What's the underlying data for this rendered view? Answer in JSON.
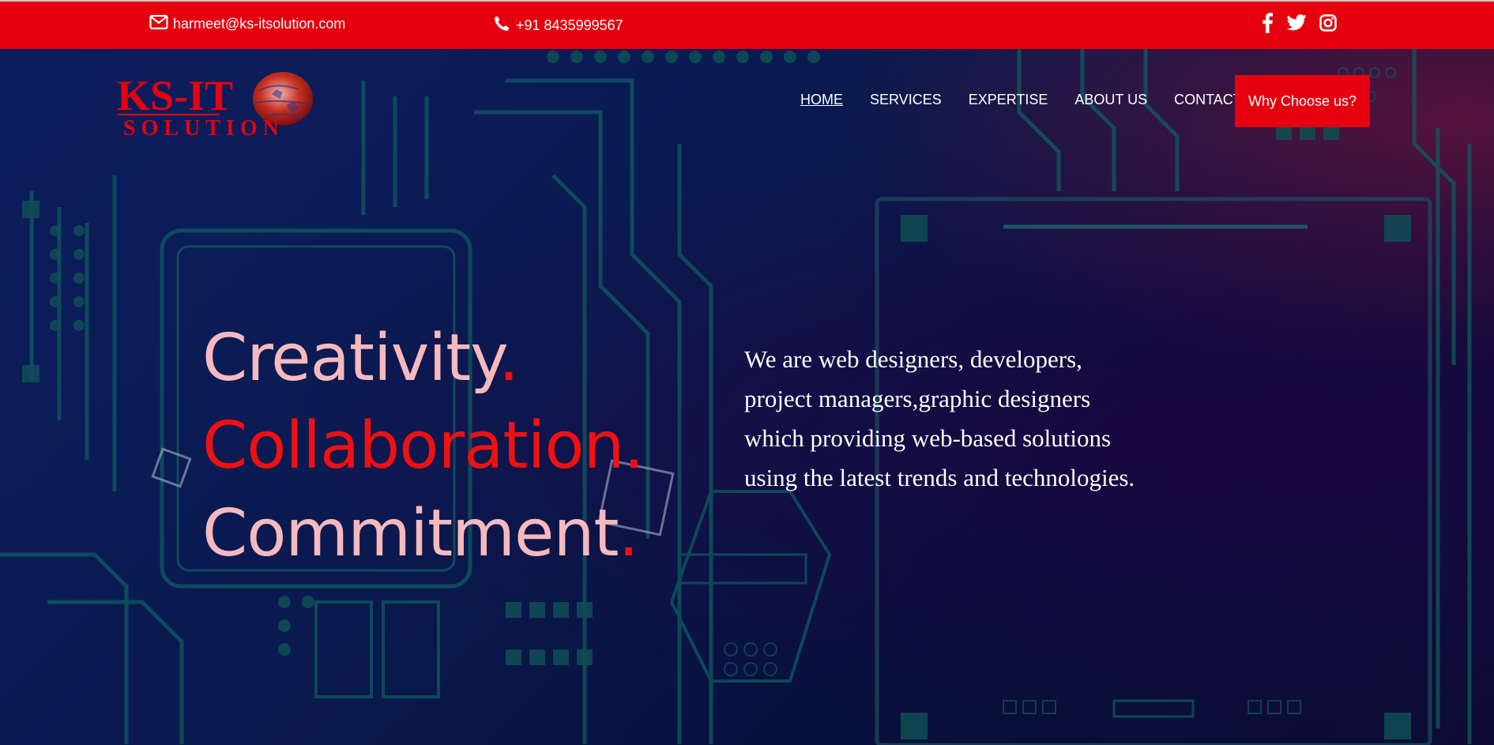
{
  "topbar": {
    "email": "harmeet@ks-itsolution.com",
    "phone": "+91 8435999567",
    "social": [
      "facebook-icon",
      "twitter-icon",
      "instagram-icon"
    ]
  },
  "brand": {
    "logo_top": "KS-IT",
    "logo_bottom": "SOLUTION",
    "accent_color": "#e6000f"
  },
  "nav": {
    "items": [
      {
        "label": "HOME",
        "active": true
      },
      {
        "label": "SERVICES",
        "active": false
      },
      {
        "label": "EXPERTISE",
        "active": false
      },
      {
        "label": "ABOUT US",
        "active": false
      },
      {
        "label": "CONTACT US",
        "active": false
      }
    ],
    "cta_label": "Why Choose us?"
  },
  "hero": {
    "line1": "Creativity",
    "line2": "Collaboration",
    "line3": "Commitment",
    "dot": ".",
    "blurb": "We are web designers, developers, project managers,graphic designers which providing web-based solutions using the latest trends and technologies."
  }
}
